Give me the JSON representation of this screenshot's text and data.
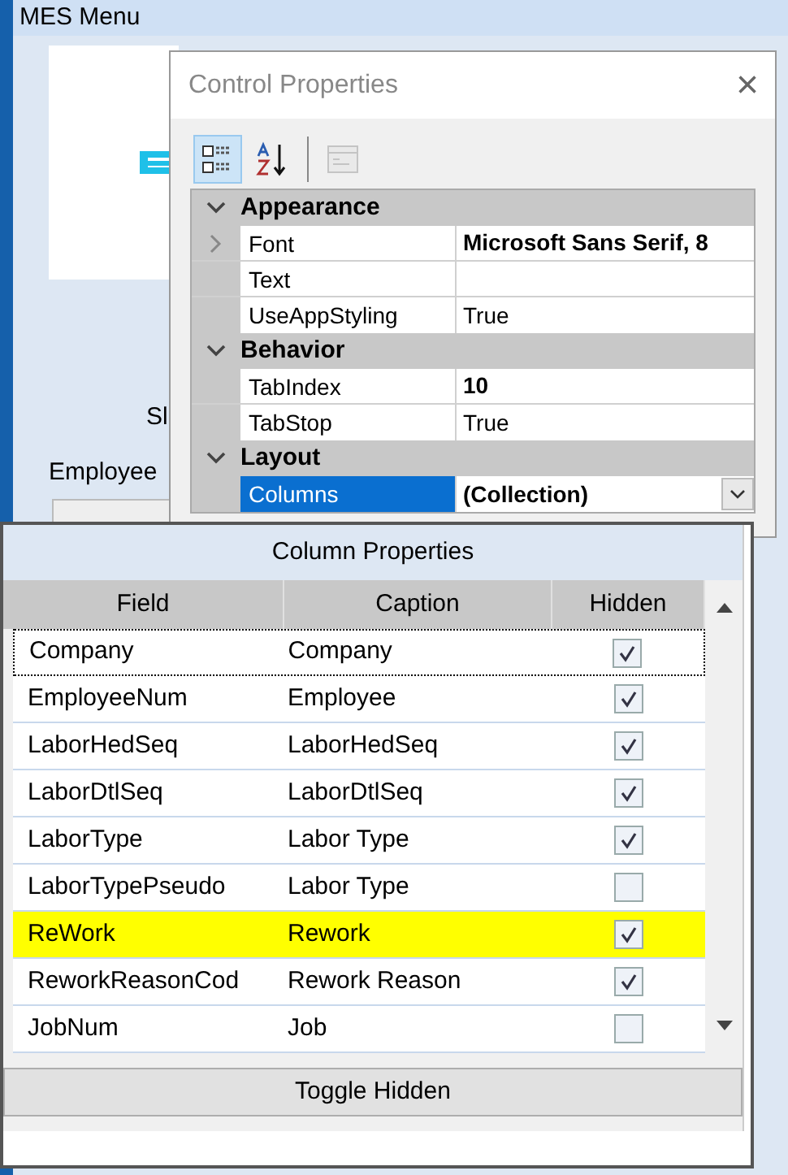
{
  "window": {
    "title": "MES Menu",
    "labels": [
      "Sl",
      "Employee"
    ]
  },
  "control_properties": {
    "title": "Control Properties",
    "close": "×",
    "toolbar": [
      {
        "kind": "categorized",
        "selected": true
      },
      {
        "kind": "alphabetical",
        "selected": false
      },
      {
        "kind": "pages",
        "selected": false,
        "disabled": true
      }
    ],
    "categories": [
      {
        "name": "Appearance",
        "expanded": true,
        "rows": [
          {
            "name": "Font",
            "value": "Microsoft Sans Serif, 8",
            "bold": true,
            "expandable": true,
            "selected": false
          },
          {
            "name": "Text",
            "expandable": false,
            "selected": false
          },
          {
            "name": "UseAppStyling",
            "value": "True",
            "bold": false,
            "expandable": false,
            "selected": false
          }
        ]
      },
      {
        "name": "Behavior",
        "expanded": true,
        "rows": [
          {
            "name": "TabIndex",
            "value": "10",
            "bold": true,
            "expandable": false,
            "selected": false
          },
          {
            "name": "TabStop",
            "value": "True",
            "bold": false,
            "expandable": false,
            "selected": false
          }
        ]
      },
      {
        "name": "Layout",
        "expanded": true,
        "rows": [
          {
            "name": "Columns",
            "value": "(Collection)",
            "bold": true,
            "expandable": false,
            "selected": true
          }
        ]
      }
    ]
  },
  "column_properties": {
    "title": "Column Properties",
    "columns": [
      "Field",
      "Caption",
      "Hidden"
    ],
    "rows": [
      {
        "field": "Company",
        "caption": "Company",
        "hidden": true,
        "focused": true,
        "highlighted": false
      },
      {
        "field": "EmployeeNum",
        "caption": "Employee",
        "hidden": true,
        "focused": false,
        "highlighted": false
      },
      {
        "field": "LaborHedSeq",
        "caption": "LaborHedSeq",
        "hidden": true,
        "focused": false,
        "highlighted": false
      },
      {
        "field": "LaborDtlSeq",
        "caption": "LaborDtlSeq",
        "hidden": true,
        "focused": false,
        "highlighted": false
      },
      {
        "field": "LaborType",
        "caption": "Labor Type",
        "hidden": true,
        "focused": false,
        "highlighted": false
      },
      {
        "field": "LaborTypePseudo",
        "caption": "Labor Type",
        "hidden": false,
        "focused": false,
        "highlighted": false
      },
      {
        "field": "ReWork",
        "caption": "Rework",
        "hidden": true,
        "focused": false,
        "highlighted": true
      },
      {
        "field": "ReworkReasonCod",
        "caption": "Rework Reason",
        "hidden": true,
        "focused": false,
        "highlighted": false
      },
      {
        "field": "JobNum",
        "caption": "Job",
        "hidden": false,
        "focused": false,
        "highlighted": false
      }
    ],
    "button": "Toggle Hidden"
  }
}
